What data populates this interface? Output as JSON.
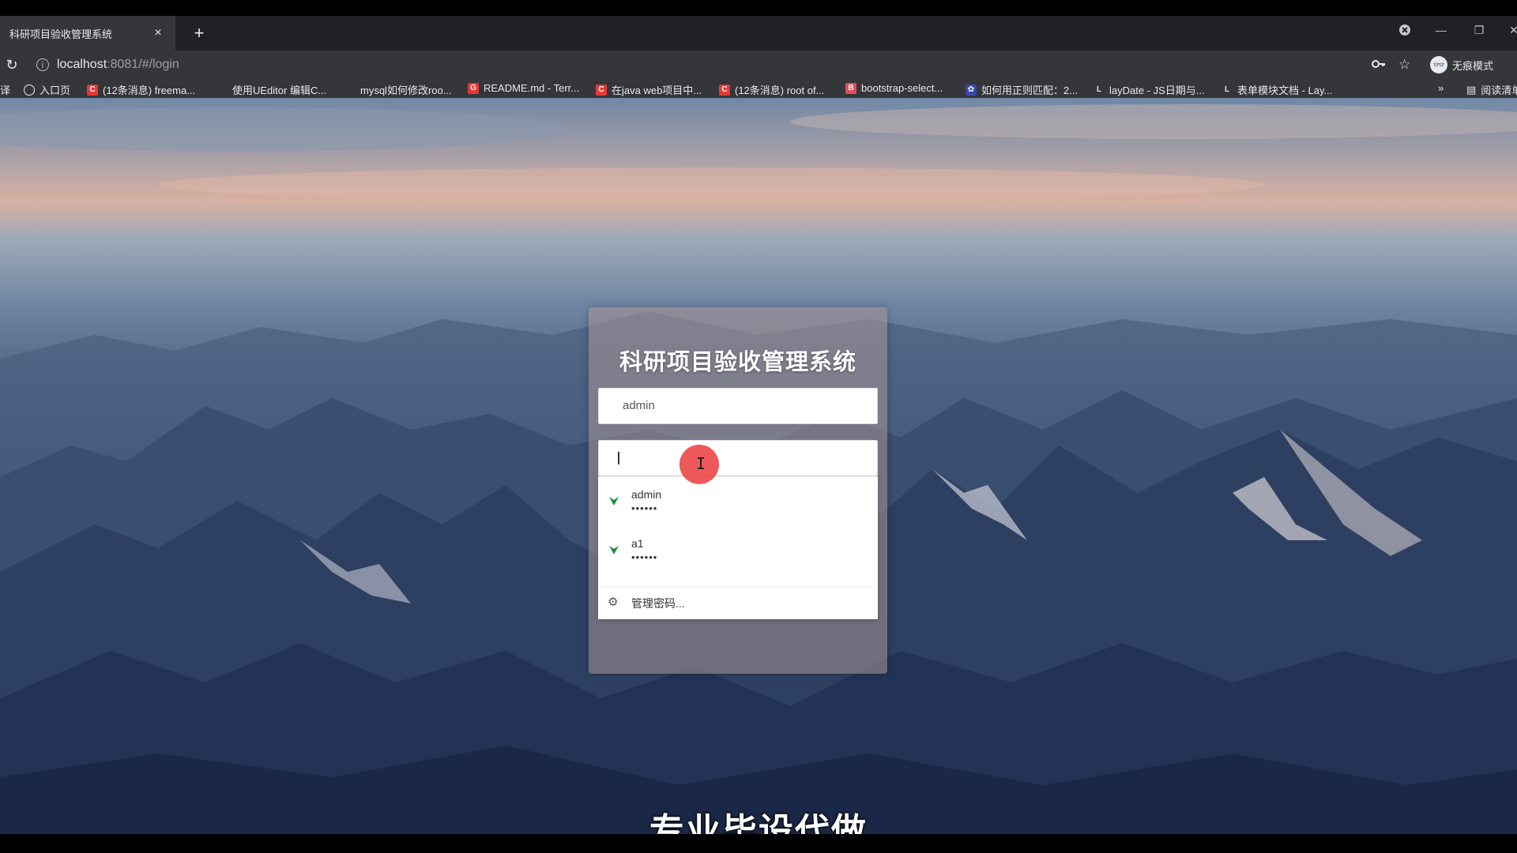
{
  "browser": {
    "tab_title": "科研项目验收管理系统",
    "tab_close": "×",
    "new_tab": "+",
    "reload_icon": "↻",
    "url_host": "localhost",
    "url_rest": ":8081/#/login",
    "incognito_label": "无痕模式",
    "window_controls": [
      "—",
      "❐",
      "✕"
    ],
    "bookmarks": [
      {
        "icon": "globe",
        "label": "入口页"
      },
      {
        "icon": "C",
        "label": "(12条消息) freema..."
      },
      {
        "icon": "",
        "label": "使用UEditor 编辑C..."
      },
      {
        "icon": "",
        "label": "mysql如何修改roo..."
      },
      {
        "icon": "G",
        "label": "README.md - Terr..."
      },
      {
        "icon": "C",
        "label": "在java web项目中..."
      },
      {
        "icon": "C",
        "label": "(12条消息) root of..."
      },
      {
        "icon": "B",
        "label": "bootstrap-select..."
      },
      {
        "icon": "paw",
        "label": "如何用正则匹配：2..."
      },
      {
        "icon": "L",
        "label": "layDate - JS日期与..."
      },
      {
        "icon": "L",
        "label": "表单模块文档 - Lay..."
      }
    ],
    "bookmarks_overflow": "»",
    "reading_list": "阅读清单",
    "left_cut_label": "译"
  },
  "login": {
    "title": "科研项目验收管理系统",
    "username_value": "admin",
    "password_value": ""
  },
  "autofill": {
    "items": [
      {
        "username": "admin",
        "password_mask": "••••••"
      },
      {
        "username": "a1",
        "password_mask": "••••••"
      }
    ],
    "manage_label": "管理密码..."
  },
  "video_subtitle": "专业毕设代做",
  "colors": {
    "card_bg": "rgba(170,150,150,0.55)",
    "key_icon": "#1e8e3e",
    "click_indicator": "#eb3c3c"
  }
}
